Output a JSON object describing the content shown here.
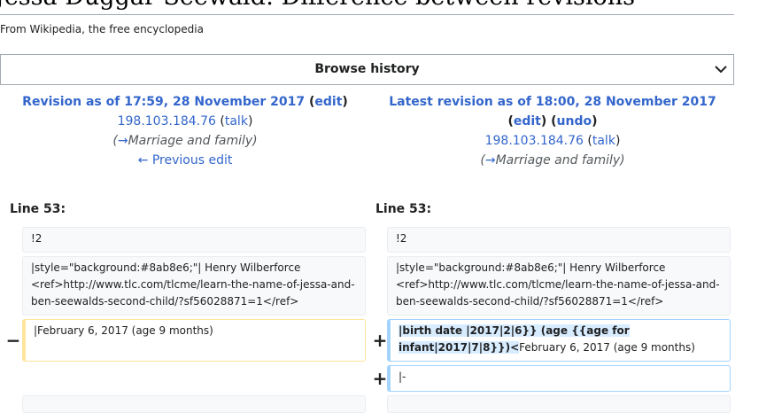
{
  "page": {
    "title": "Jessa Duggar Seewald: Difference between revisions",
    "subtitle": "From Wikipedia, the free encyclopedia",
    "browse_label": "Browse history"
  },
  "left": {
    "revision_link": "Revision as of 17:59, 28 November 2017",
    "edit": "edit",
    "user": "198.103.184.76",
    "talk": "talk",
    "comment_arrow": "→",
    "comment": "Marriage and family",
    "prev_edit": "← Previous edit",
    "line": "Line 53:"
  },
  "right": {
    "revision_link": "Latest revision as of 18:00, 28 November 2017",
    "edit": "edit",
    "undo": "undo",
    "user": "198.103.184.76",
    "talk": "talk",
    "comment_arrow": "→",
    "comment": "Marriage and family",
    "line": "Line 53:"
  },
  "diff": {
    "ctx1": "!2",
    "ctx2": "|style=\"background:#8ab8e6;\"| Henry Wilberforce <ref>http://www.tlc.com/tlcme/learn-the-name-of-jessa-and-ben-seewalds-second-child/?sf56028871=1</ref>",
    "deleted": "|February 6, 2017 (age 9 months)",
    "added_hl1": "|birth date |2017|2|6}} (age {{age for",
    "added_hl2": "infant|2017|7|8}})<",
    "added_rest": "February 6, 2017 (age 9 months)",
    "added2": "|-",
    "minus": "−",
    "plus": "+"
  }
}
